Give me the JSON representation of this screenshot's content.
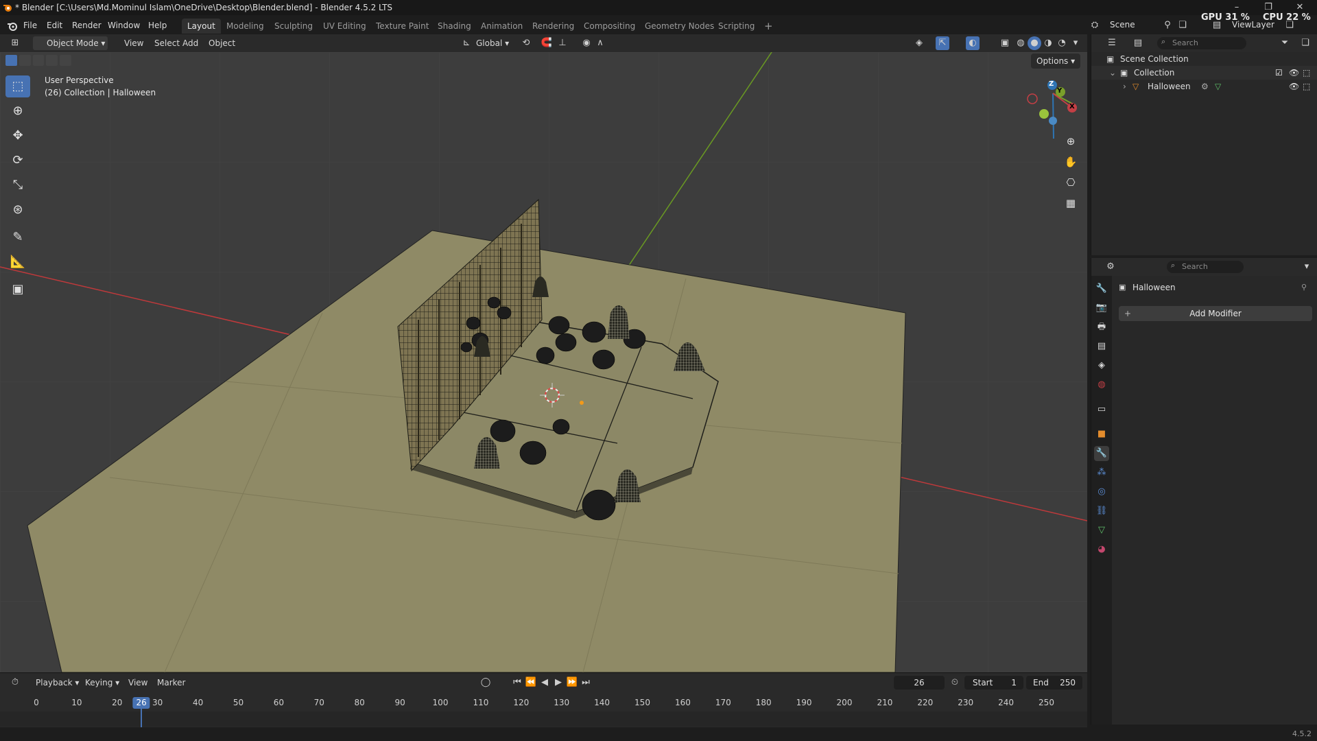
{
  "window": {
    "title": "* Blender [C:\\Users\\Md.Mominul Islam\\OneDrive\\Desktop\\Blender.blend] - Blender 4.5.2 LTS"
  },
  "menu": [
    "File",
    "Edit",
    "Render",
    "Window",
    "Help"
  ],
  "workspaces": [
    "Layout",
    "Modeling",
    "Sculpting",
    "UV Editing",
    "Texture Paint",
    "Shading",
    "Animation",
    "Rendering",
    "Compositing",
    "Geometry Nodes",
    "Scripting"
  ],
  "active_workspace": "Layout",
  "scene_name": "Scene",
  "view_layer": "ViewLayer",
  "monitor": {
    "gpu": "GPU 31 %",
    "cpu": "CPU 22 %"
  },
  "viewport_header": {
    "mode": "Object Mode",
    "menus": [
      "View",
      "Select",
      "Add",
      "Object"
    ],
    "transform_orientation": "Global",
    "options_label": "Options"
  },
  "viewport": {
    "perspective_label": "User Perspective",
    "collection_label": "(26) Collection | Halloween",
    "gizmo_axes": [
      "X",
      "Y",
      "Z"
    ]
  },
  "outliner": {
    "search_placeholder": "Search",
    "scene_collection": "Scene Collection",
    "collection": "Collection",
    "object": "Halloween"
  },
  "properties": {
    "search_placeholder": "Search",
    "object_name": "Halloween",
    "add_modifier_label": "Add Modifier"
  },
  "timeline": {
    "menus": [
      "Playback",
      "Keying",
      "View",
      "Marker"
    ],
    "current_frame": "26",
    "start_label": "Start",
    "start_value": "1",
    "end_label": "End",
    "end_value": "250",
    "ticks": [
      "0",
      "10",
      "20",
      "30",
      "40",
      "50",
      "60",
      "70",
      "80",
      "90",
      "100",
      "110",
      "120",
      "130",
      "140",
      "150",
      "160",
      "170",
      "180",
      "190",
      "200",
      "210",
      "220",
      "230",
      "240",
      "250"
    ]
  },
  "status": {
    "version": "4.5.2"
  },
  "colors": {
    "accent": "#4772b3",
    "floor": "#8f8a66",
    "x_axis": "#c0393b",
    "y_axis": "#6a9a22"
  }
}
